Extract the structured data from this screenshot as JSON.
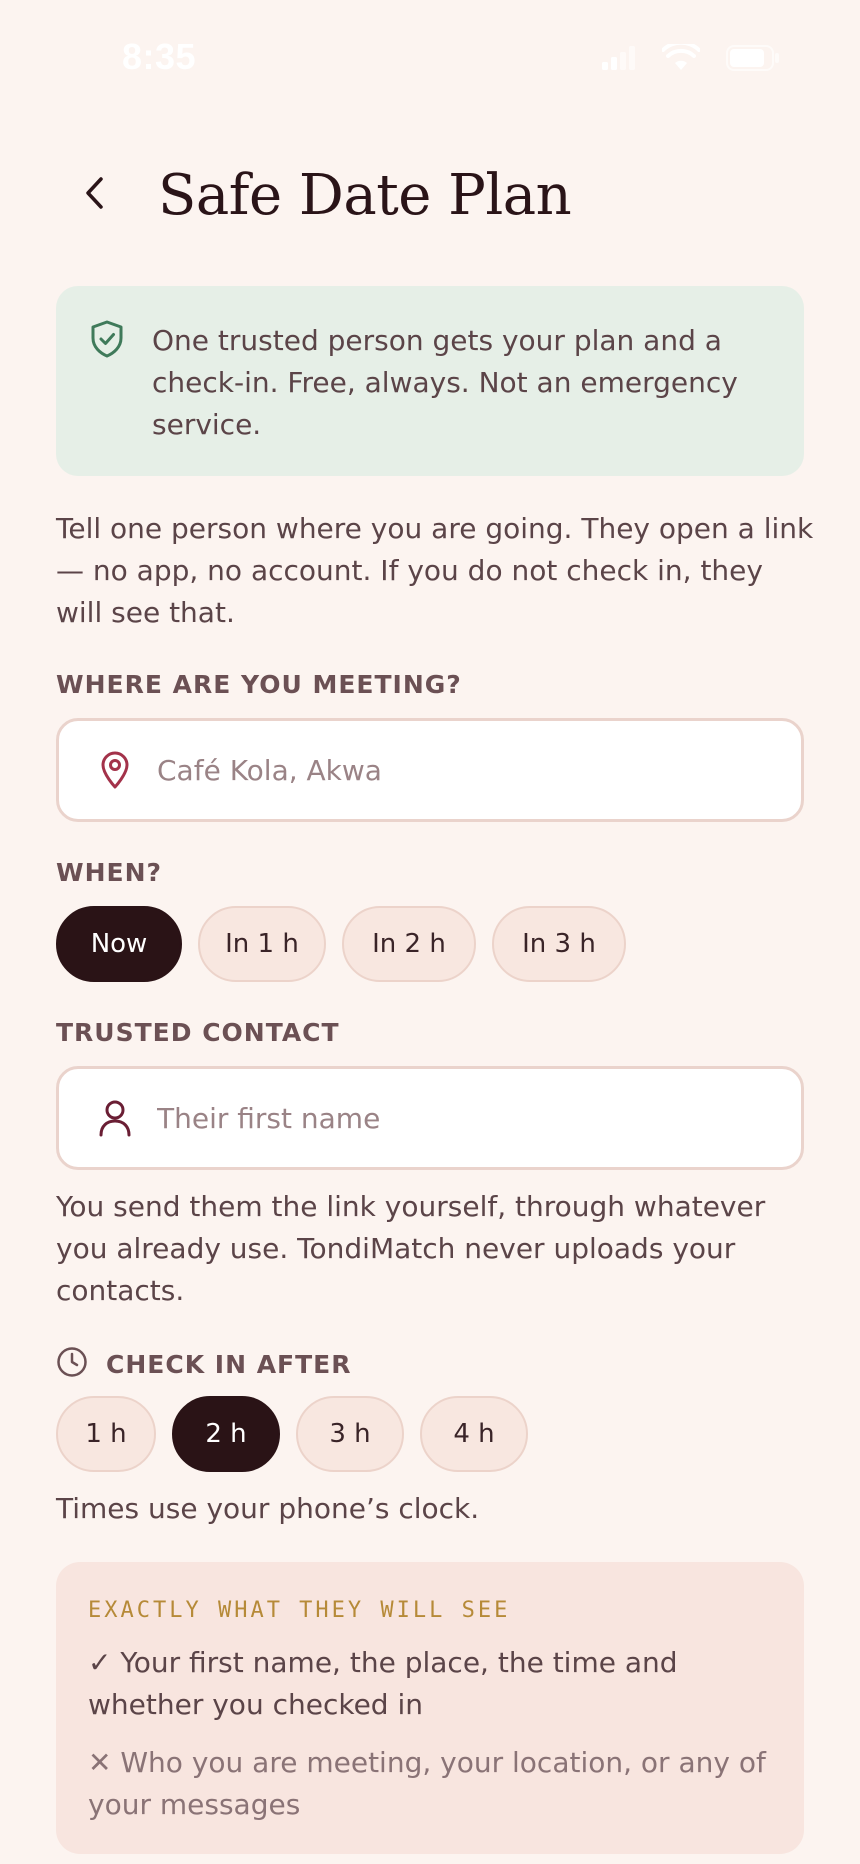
{
  "status_bar": {
    "time": "8:35"
  },
  "header": {
    "title": "Safe Date Plan",
    "back_icon": "chevron-left-icon"
  },
  "info_banner": {
    "icon": "shield-check-icon",
    "text": "One trusted person gets your plan and a check-in. Free, always. Not an emergency service.",
    "background": "#e6efe7",
    "icon_color": "#3f7a5a"
  },
  "intro": {
    "text": "Tell one person where you are going. They open a link — no app, no account. If you do not check in, they will see that."
  },
  "meeting": {
    "label": "WHERE ARE YOU MEETING?",
    "icon": "map-pin-icon",
    "placeholder": "Café Kola, Akwa",
    "value": ""
  },
  "when": {
    "label": "WHEN?",
    "options": [
      "Now",
      "In 1 h",
      "In 2 h",
      "In 3 h"
    ],
    "selected": "Now"
  },
  "contact": {
    "label": "TRUSTED CONTACT",
    "icon": "user-icon",
    "placeholder": "Their first name",
    "value": "",
    "helper": "You send them the link yourself, through whatever you already use. TondiMatch never uploads your contacts."
  },
  "checkin": {
    "label": "CHECK IN AFTER",
    "icon": "clock-icon",
    "options": [
      "1 h",
      "2 h",
      "3 h",
      "4 h"
    ],
    "selected": "2 h",
    "helper": "Times use your phone’s clock."
  },
  "preview": {
    "title": "EXACTLY WHAT THEY WILL SEE",
    "shown": "✓ Your first name, the place, the time and whether you checked in",
    "hidden": "✕ Who you are meeting, your location, or any of your messages",
    "accent": "#b68a38"
  },
  "colors": {
    "background": "#fcf4f0",
    "dark": "#2a1316",
    "brand": "#a3324a",
    "chip": "#f8e7e0"
  }
}
